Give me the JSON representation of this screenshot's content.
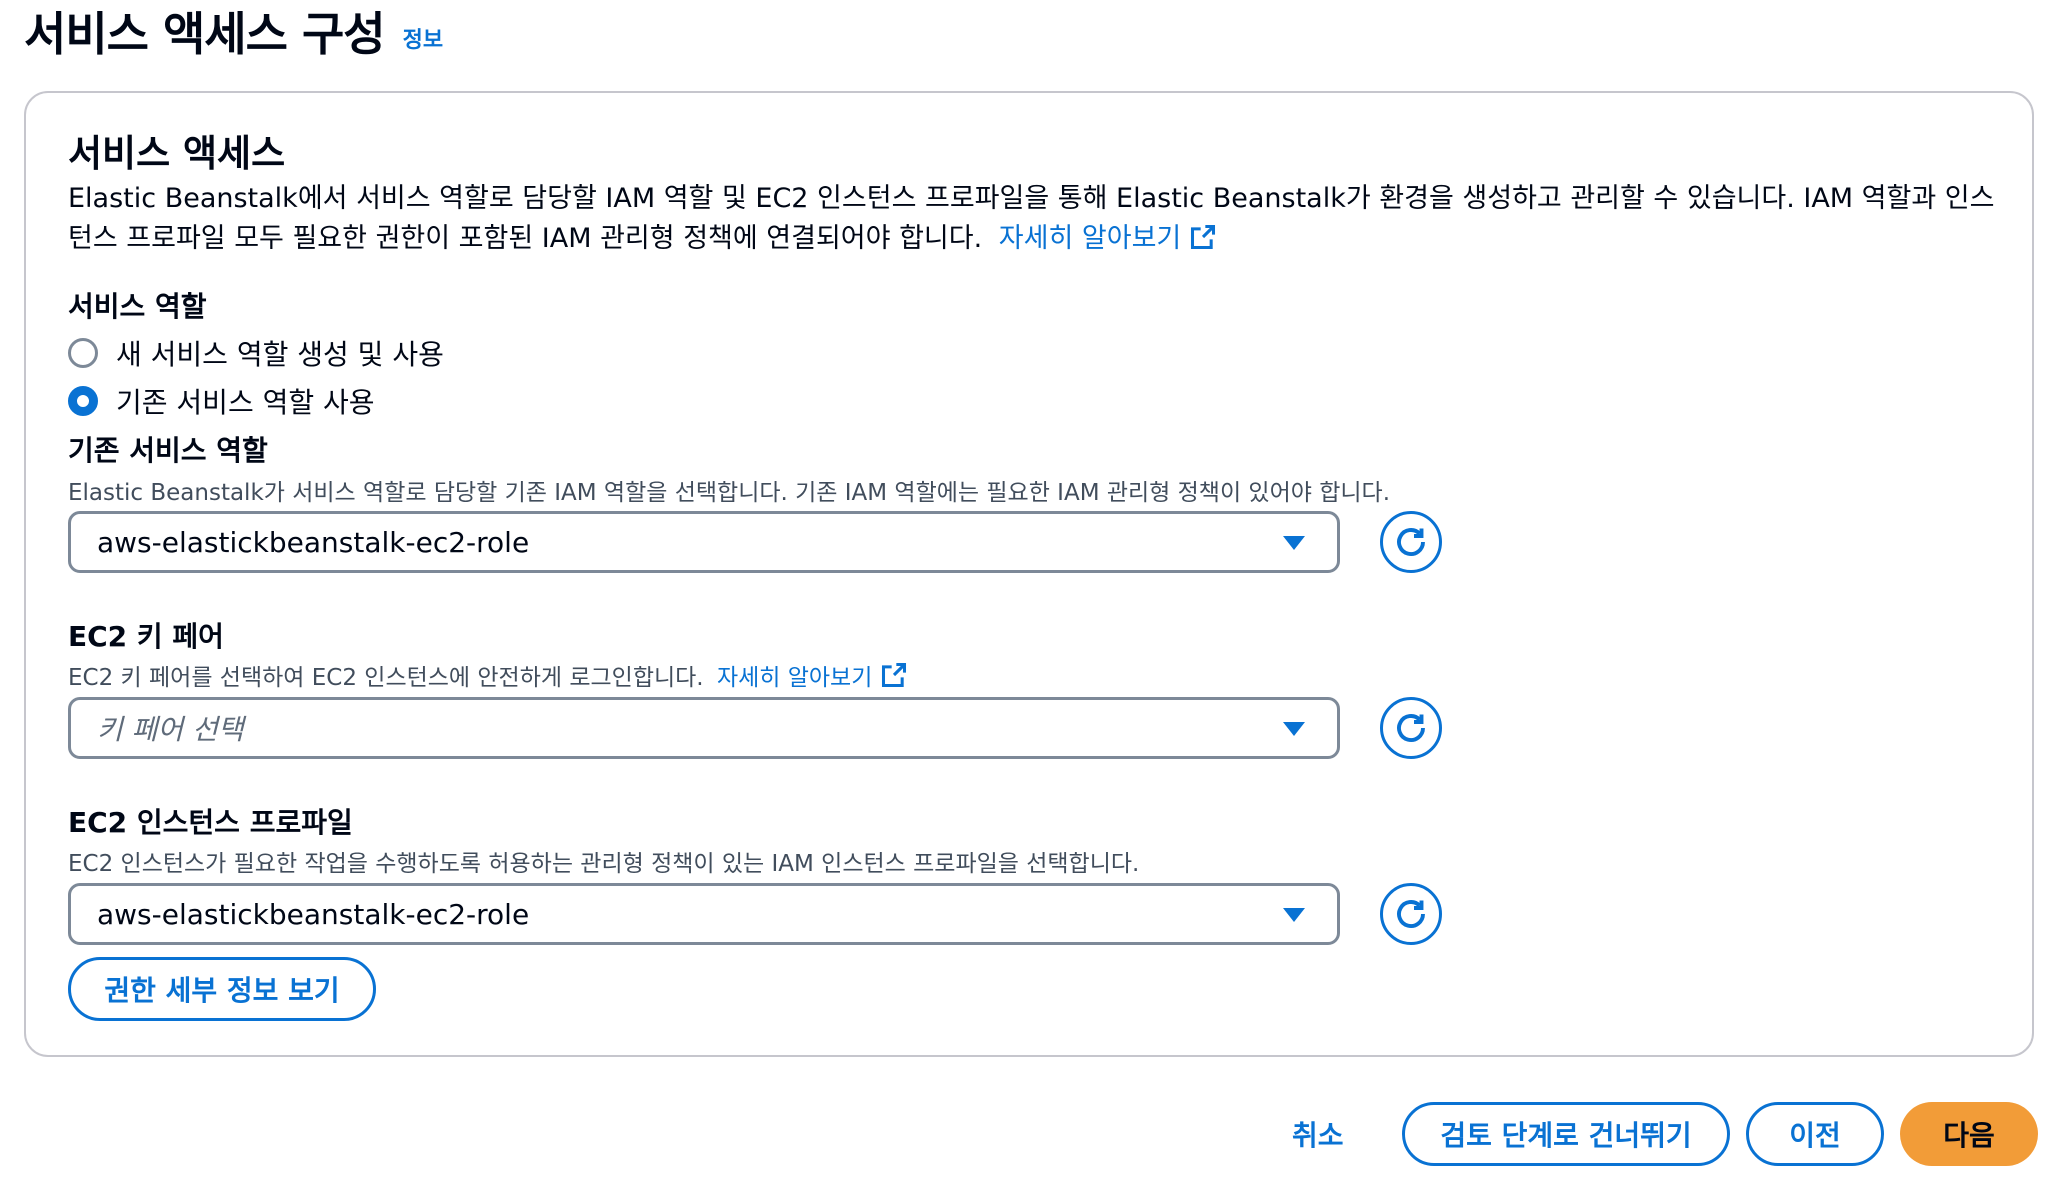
{
  "header": {
    "title": "서비스 액세스 구성",
    "info_link": "정보"
  },
  "section": {
    "title": "서비스 액세스",
    "description": "Elastic Beanstalk에서 서비스 역할로 담당할 IAM 역할 및 EC2 인스턴스 프로파일을 통해 Elastic Beanstalk가 환경을 생성하고 관리할 수 있습니다. IAM 역할과 인스턴스 프로파일 모두 필요한 권한이 포함된 IAM 관리형 정책에 연결되어야 합니다.",
    "learn_more": "자세히 알아보기"
  },
  "service_role": {
    "label": "서비스 역할",
    "options": [
      {
        "label": "새 서비스 역할 생성 및 사용",
        "checked": false
      },
      {
        "label": "기존 서비스 역할 사용",
        "checked": true
      }
    ]
  },
  "existing_role": {
    "label": "기존 서비스 역할",
    "description": "Elastic Beanstalk가 서비스 역할로 담당할 기존 IAM 역할을 선택합니다. 기존 IAM 역할에는 필요한 IAM 관리형 정책이 있어야 합니다.",
    "value": "aws-elastickbeanstalk-ec2-role"
  },
  "key_pair": {
    "label": "EC2 키 페어",
    "description": "EC2 키 페어를 선택하여 EC2 인스턴스에 안전하게 로그인합니다.",
    "learn_more": "자세히 알아보기",
    "placeholder": "키 페어 선택"
  },
  "instance_profile": {
    "label": "EC2 인스턴스 프로파일",
    "description": "EC2 인스턴스가 필요한 작업을 수행하도록 허용하는 관리형 정책이 있는 IAM 인스턴스 프로파일을 선택합니다.",
    "value": "aws-elastickbeanstalk-ec2-role"
  },
  "view_permissions_button": "권한 세부 정보 보기",
  "footer": {
    "cancel": "취소",
    "skip_to_review": "검토 단계로 건너뛰기",
    "previous": "이전",
    "next": "다음"
  },
  "colors": {
    "link": "#0972d3",
    "primary_button": "#f29c38",
    "border": "#7d8998"
  }
}
